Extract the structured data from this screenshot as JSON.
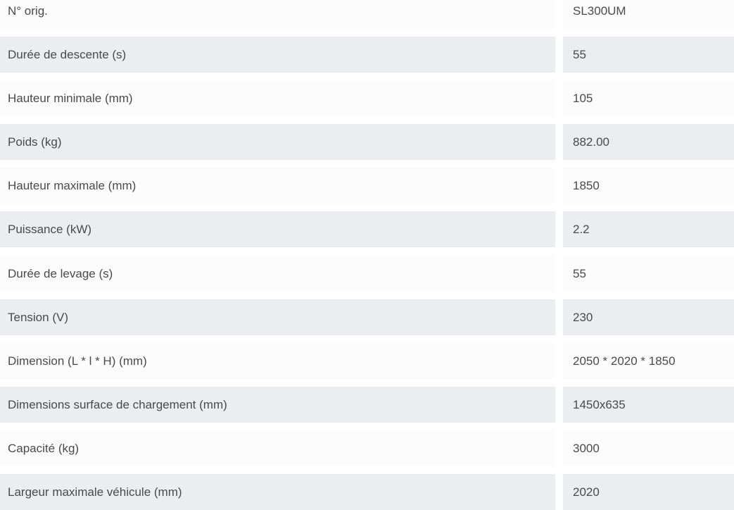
{
  "colors": {
    "row_shaded": "#eaeeef",
    "row_plain": "#fcfcfc",
    "text": "#4a4a4a"
  },
  "specs": [
    {
      "label": "N° orig.",
      "value": "SL300UM"
    },
    {
      "label": "Durée de descente (s)",
      "value": "55"
    },
    {
      "label": "Hauteur minimale (mm)",
      "value": "105"
    },
    {
      "label": "Poids (kg)",
      "value": "882.00"
    },
    {
      "label": "Hauteur maximale (mm)",
      "value": "1850"
    },
    {
      "label": "Puissance (kW)",
      "value": "2.2"
    },
    {
      "label": "Durée de levage (s)",
      "value": "55"
    },
    {
      "label": "Tension (V)",
      "value": "230"
    },
    {
      "label": "Dimension (L * l * H) (mm)",
      "value": "2050 * 2020 * 1850"
    },
    {
      "label": "Dimensions surface de chargement (mm)",
      "value": "1450x635"
    },
    {
      "label": "Capacité (kg)",
      "value": "3000"
    },
    {
      "label": "Largeur maximale véhicule (mm)",
      "value": "2020"
    }
  ]
}
